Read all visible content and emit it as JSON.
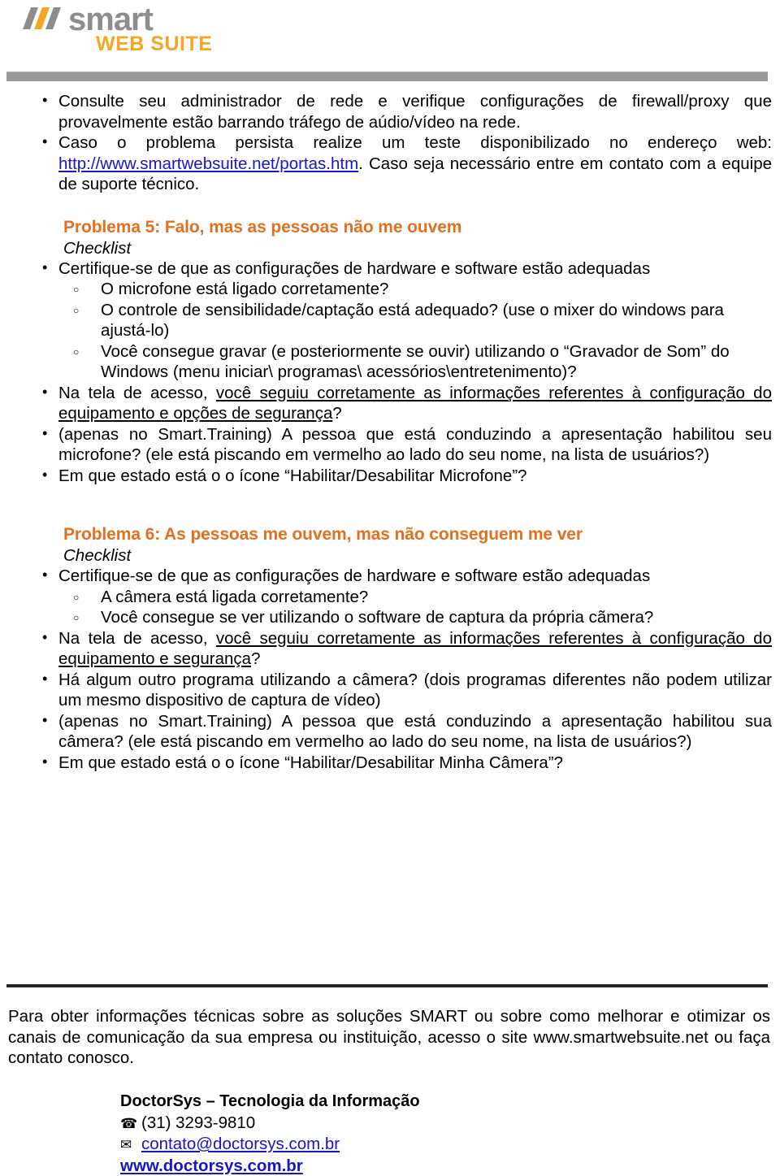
{
  "header": {
    "logo_alt": "smart WEB SUITE",
    "logo_primary": "smart",
    "logo_secondary": "WEB SUITE",
    "logo_gray": "#8d8d8d",
    "logo_orange": "#F5A623",
    "rule_color": "#9a9a9a"
  },
  "top_bullets": [
    {
      "text": "Consulte seu administrador de rede e verifique configurações de firewall/proxy que provavelmente estão barrando tráfego de aúdio/vídeo na rede."
    },
    {
      "pre": "Caso o problema persista realize um teste disponibilizado no endereço web: ",
      "link": "http://www.smartwebsuite.net/portas.htm",
      "post": ". Caso seja necessário entre em contato com a equipe de suporte técnico."
    }
  ],
  "problema5": {
    "heading": "Problema 5: Falo, mas as pessoas não me ouvem",
    "checklist_label": "Checklist",
    "bullet_main": "Certifique-se de que as configurações de hardware e software estão adequadas",
    "sub_items": [
      "O microfone está ligado corretamente?",
      "O controle de sensibilidade/captação está adequado? (use o mixer do windows para ajustá-lo)",
      "Você consegue gravar (e posteriormente se ouvir) utilizando o “Gravador de Som” do Windows (menu iniciar\\ programas\\ acessórios\\entretenimento)?"
    ],
    "bullets_after": [
      {
        "pre": "Na tela de acesso, ",
        "underline": "você seguiu corretamente as informações referentes à configuração do equipamento e opções de segurança",
        "post": "?"
      },
      {
        "text": "(apenas no Smart.Training) A pessoa que está conduzindo a apresentação habilitou seu microfone? (ele está piscando em vermelho ao lado do seu nome, na lista de usuários?)"
      },
      {
        "text": "Em que estado está o o ícone “Habilitar/Desabilitar Microfone”?"
      }
    ]
  },
  "problema6": {
    "heading": "Problema 6: As pessoas me ouvem, mas não conseguem me ver",
    "checklist_label": "Checklist",
    "bullet_main": "Certifique-se de que as configurações de hardware e software estão adequadas",
    "sub_items": [
      "A câmera está ligada corretamente?",
      "Você consegue se ver utilizando o software de captura da própria cãmera?"
    ],
    "bullets_after": [
      {
        "pre": "Na tela de acesso, ",
        "underline": "você seguiu corretamente as informações referentes à configuração do equipamento e segurança",
        "post": "?"
      },
      {
        "text": "Há algum outro programa utilizando a câmera? (dois programas diferentes não podem utilizar um mesmo dispositivo de captura de vídeo)"
      },
      {
        "text": "(apenas no Smart.Training) A pessoa que está conduzindo a apresentação habilitou sua câmera? (ele está piscando em vermelho ao lado do seu nome, na lista de usuários?)"
      },
      {
        "text": "Em que estado está o o ícone “Habilitar/Desabilitar Minha Câmera”?"
      }
    ]
  },
  "footer": {
    "paragraph": "Para obter informações técnicas sobre as soluções SMART ou sobre como melhorar e otimizar os canais de comunicação da sua empresa ou instituição, acesso o site www.smartwebsuite.net ou faça contato conosco.",
    "company": "DoctorSys – Tecnologia da Informação",
    "phone_icon": "phone-icon",
    "phone_glyph": "☎",
    "phone": "(31) 3293-9810",
    "mail_icon": "envelope-icon",
    "mail_glyph": "✉",
    "email": "contato@doctorsys.com.br",
    "website": "www.doctorsys.com.br",
    "rule_color": "#262626",
    "link_color": "#1515CC"
  }
}
